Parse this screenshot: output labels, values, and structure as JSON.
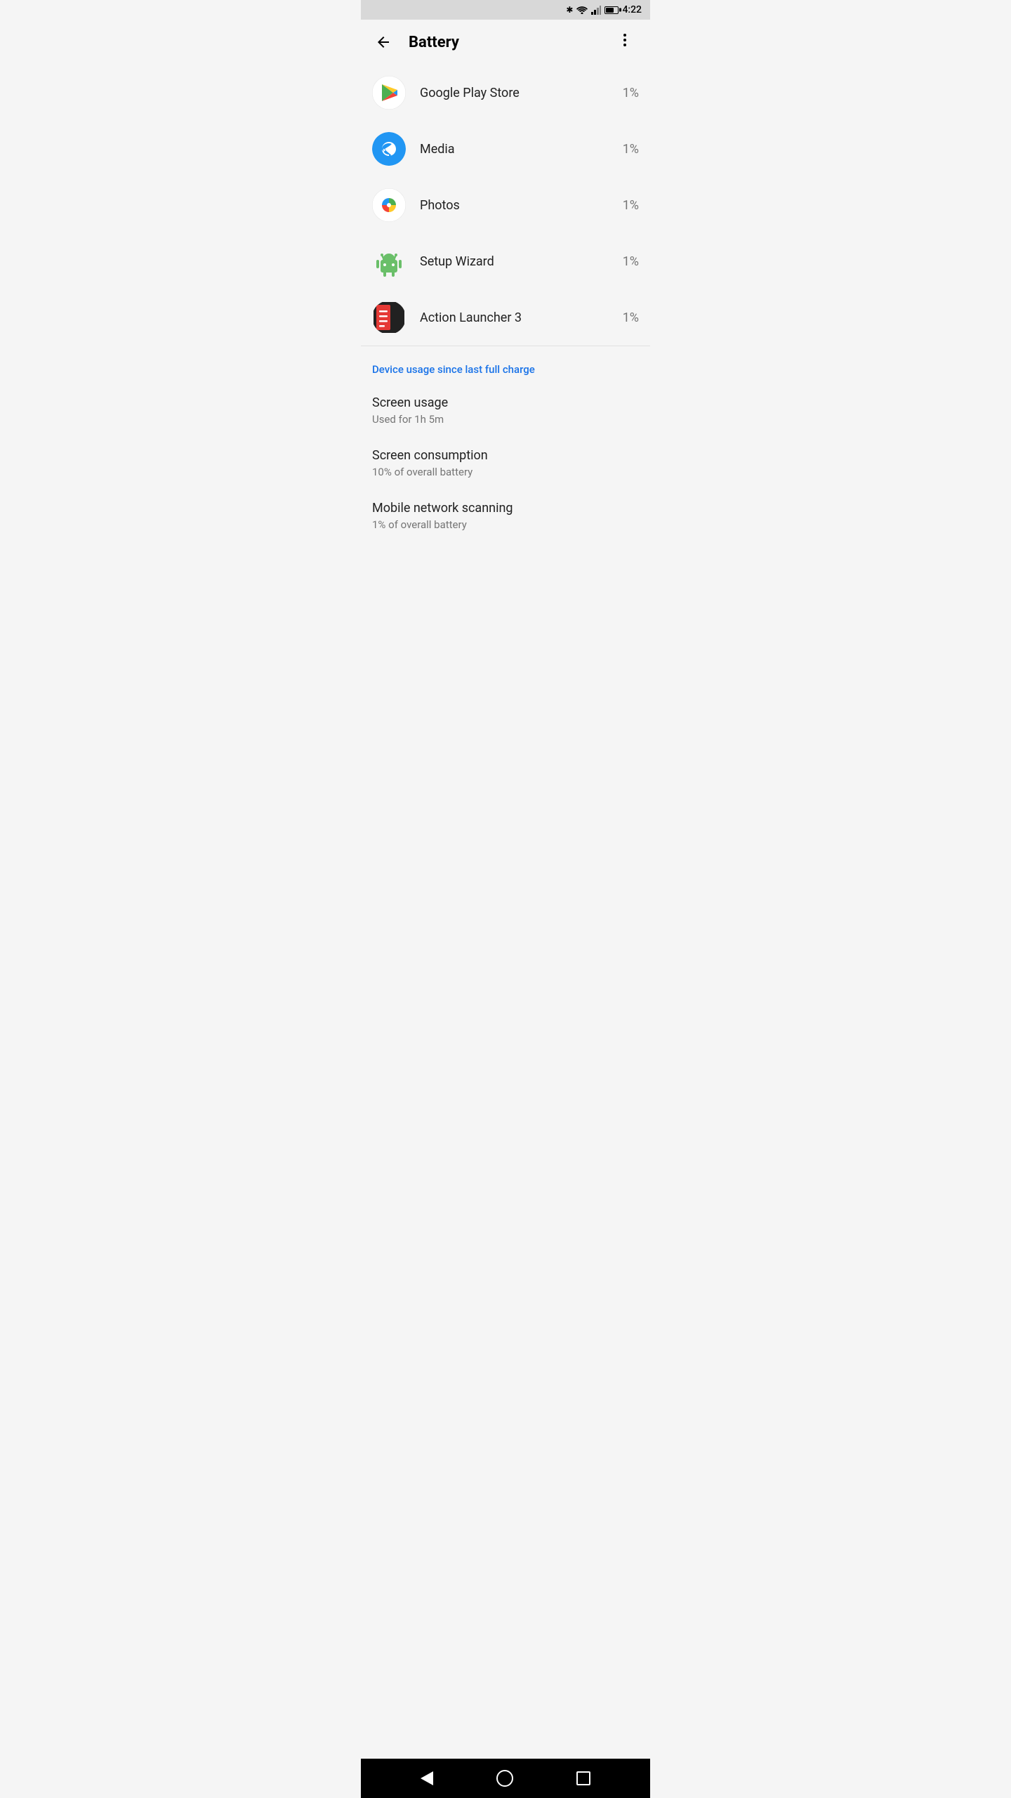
{
  "statusBar": {
    "time": "4:22",
    "batteryIcon": "battery",
    "wifiIcon": "wifi",
    "signalIcon": "signal",
    "bluetoothIcon": "bluetooth"
  },
  "toolbar": {
    "backLabel": "←",
    "title": "Battery",
    "moreLabel": "⋮"
  },
  "appList": [
    {
      "id": "google-play-store",
      "name": "Google Play Store",
      "usage": "1%",
      "iconType": "play"
    },
    {
      "id": "media",
      "name": "Media",
      "usage": "1%",
      "iconType": "media"
    },
    {
      "id": "photos",
      "name": "Photos",
      "usage": "1%",
      "iconType": "photos"
    },
    {
      "id": "setup-wizard",
      "name": "Setup Wizard",
      "usage": "1%",
      "iconType": "android"
    },
    {
      "id": "action-launcher",
      "name": "Action Launcher 3",
      "usage": "1%",
      "iconType": "launcher"
    }
  ],
  "deviceUsageSection": {
    "sectionTitle": "Device usage since last full charge",
    "items": [
      {
        "id": "screen-usage",
        "title": "Screen usage",
        "subtitle": "Used for 1h 5m"
      },
      {
        "id": "screen-consumption",
        "title": "Screen consumption",
        "subtitle": "10% of overall battery"
      },
      {
        "id": "mobile-network-scanning",
        "title": "Mobile network scanning",
        "subtitle": "1% of overall battery"
      }
    ]
  },
  "navBar": {
    "backLabel": "◀",
    "homeLabel": "○",
    "recentLabel": "□"
  }
}
